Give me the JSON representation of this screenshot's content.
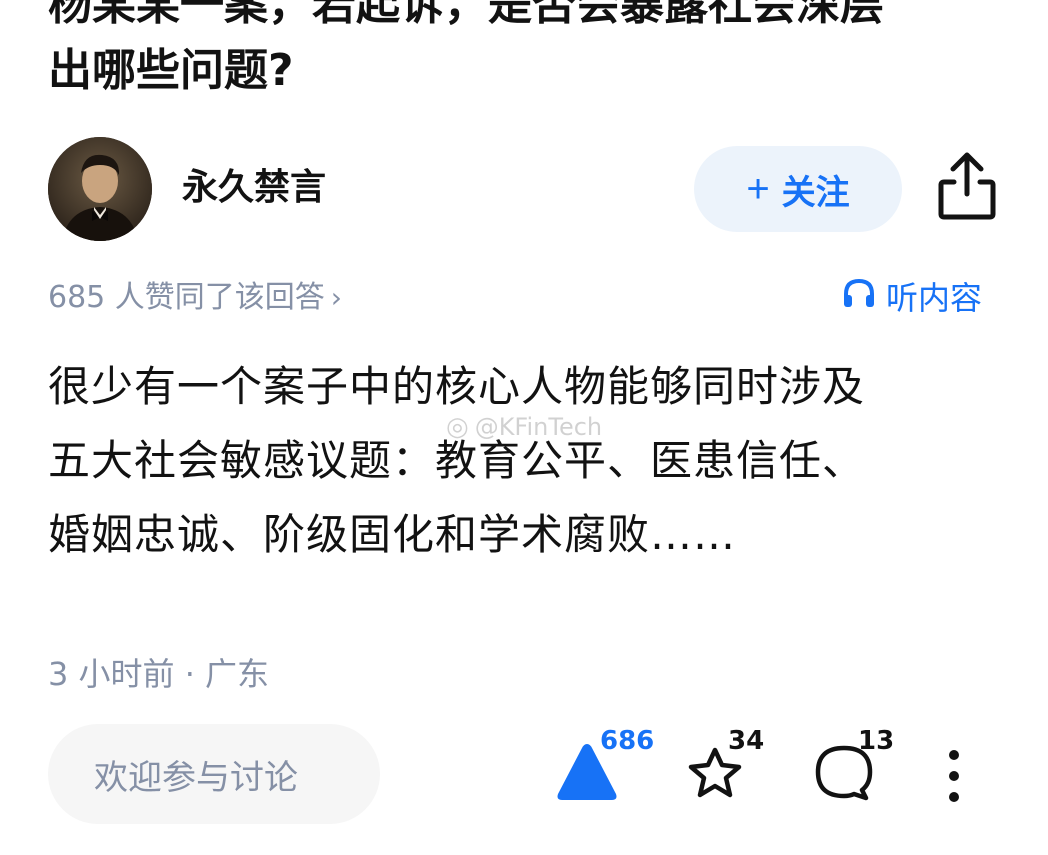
{
  "question": {
    "title_line1": "杨某某一案，若起诉，是否会暴露社会深层",
    "title_line2": "出哪些问题?"
  },
  "author": {
    "name": "永久禁言",
    "follow_label": "关注",
    "follow_prefix": "+"
  },
  "meta": {
    "votes_text": "685 人赞同了该回答",
    "votes_chevron": "›",
    "listen_label": "听内容"
  },
  "answer": {
    "lines": [
      "很少有一个案子中的核心人物能够同时涉及",
      "五大社会敏感议题：教育公平、医患信任、",
      "婚姻忠诚、阶级固化和学术腐败……"
    ],
    "watermark": "@KFinTech"
  },
  "time": {
    "text": "3 小时前 · 广东"
  },
  "bottom": {
    "comment_placeholder": "欢迎参与讨论",
    "vote_count": "686",
    "star_count": "34",
    "comment_count": "13"
  },
  "colors": {
    "accent": "#1772f6",
    "follow_bg": "#ecf3fb",
    "meta_gray": "#8590a6",
    "text": "#121212"
  },
  "icons": {
    "share": "share-icon",
    "headphones": "headphones-icon",
    "vote": "vote-up-icon",
    "star": "star-icon",
    "comment": "comment-icon",
    "more": "more-vertical-icon"
  }
}
